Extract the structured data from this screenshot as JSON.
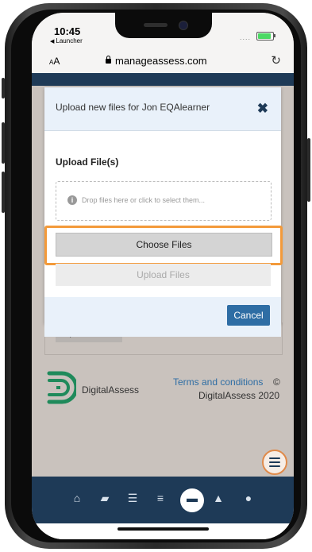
{
  "status_bar": {
    "time": "10:45",
    "back_app": "Launcher",
    "signal": "....",
    "battery_color": "#4cd964"
  },
  "browser": {
    "text_size_label": "AA",
    "url": "manageassess.com",
    "reload_icon": "reload-icon"
  },
  "dialog": {
    "title": "Upload new files for Jon EQAlearner",
    "close_icon": "close-icon",
    "section_label": "Upload File(s)",
    "dropzone_text": "Drop files here or click to select them...",
    "choose_files_label": "Choose Files",
    "upload_files_label": "Upload Files",
    "cancel_label": "Cancel",
    "highlight_color": "#f39a3a"
  },
  "page": {
    "background_upload_button": "Upload Files"
  },
  "footer": {
    "brand": "DigitalAssess",
    "terms_link": "Terms and conditions",
    "copyright_symbol": "©",
    "copyright_text": "DigitalAssess 2020"
  },
  "bottom_nav": {
    "items": [
      {
        "icon": "home-icon"
      },
      {
        "icon": "book-icon"
      },
      {
        "icon": "list-icon"
      },
      {
        "icon": "checklist-icon"
      },
      {
        "icon": "folder-icon",
        "active": true
      },
      {
        "icon": "graduation-cap-icon"
      },
      {
        "icon": "users-icon"
      }
    ],
    "menu_icon": "hamburger-menu-icon"
  },
  "colors": {
    "brand_navy": "#1e3a57",
    "accent_blue": "#2e6da4",
    "logo_green": "#1f8a5b"
  }
}
